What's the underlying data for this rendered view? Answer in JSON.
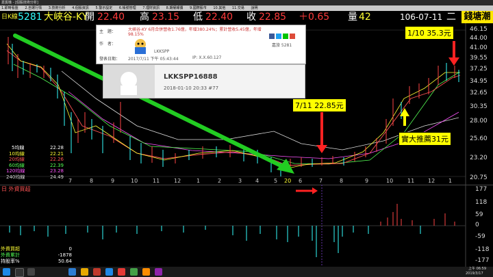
{
  "window": {
    "title": "嘉賓機 - [個股技術分析]",
    "menu": [
      "1.即時看盤",
      "2.自選行情",
      "3.技術分析",
      "4.個股資訊",
      "5.警示設定",
      "6.帳號管理",
      "7.理財資訊",
      "8.期權報價",
      "9.國際股市",
      "10.其他",
      "11.交易",
      "說明"
    ]
  },
  "quote": {
    "tag": "日K線",
    "code": "5281",
    "name": "大峽谷-KY",
    "open_label": "開",
    "open": "22.40",
    "high_label": "高",
    "high": "23.15",
    "low_label": "低",
    "low": "22.40",
    "close_label": "收",
    "close": "22.85",
    "change": "＋0.65",
    "volume_label": "量",
    "volume": "42",
    "date": "106-07-11",
    "weekday": "二",
    "brand": "錢塘潮"
  },
  "price_axis": [
    "46.15",
    "44.00",
    "41.00",
    "39.55",
    "37.25",
    "34.95",
    "32.65",
    "30.35",
    "28.00",
    "25.60",
    "23.20",
    "20.75"
  ],
  "x_axis": [
    "6",
    "7",
    "8",
    "9",
    "10",
    "11",
    "12",
    "1",
    "2",
    "3",
    "4",
    "5",
    "6",
    "7",
    "8",
    "9",
    "10",
    "11",
    "12",
    "1"
  ],
  "x_axis_special": "20",
  "ma_legend": [
    {
      "label": "5均線",
      "value": "22.28",
      "color": "#ffffff"
    },
    {
      "label": "10均線",
      "value": "22.21",
      "color": "#ffff33"
    },
    {
      "label": "20均線",
      "value": "22.26",
      "color": "#ff5555"
    },
    {
      "label": "60均線",
      "value": "22.39",
      "color": "#55ff55"
    },
    {
      "label": "120均線",
      "value": "23.28",
      "color": "#ff55ff"
    },
    {
      "label": "240均線",
      "value": "24.49",
      "color": "#dddddd"
    }
  ],
  "indicator": {
    "tag": "日 外資買超",
    "axis": [
      "177",
      "118",
      "59",
      "0",
      "-59",
      "-118",
      "-177"
    ],
    "legend": [
      {
        "label": "外資買超",
        "value": "0",
        "color": "#ffff33"
      },
      {
        "label": "外資累計",
        "value": "-1878",
        "color": "#55ff55"
      },
      {
        "label": "持股率%",
        "value": "50.64",
        "color": "#ffffff"
      }
    ]
  },
  "post": {
    "subject_label": "主　題：",
    "subject": "大峽谷-KY 6月合併營收1.76億，年增380.24%；累計營收5.45億，年增98.15%",
    "author_label": "作　者：",
    "author": "LKKSPP",
    "stock_label": "股票：",
    "stock_tag": "嘉旅 5281",
    "time_label": "發表日期：",
    "time": "2017/7/11 下午 05:43:44",
    "ip": "IP: X.X.60.127"
  },
  "profile": {
    "name": "LKKSPP16888",
    "meta": "2018-01-10 20:33  #77"
  },
  "callouts": {
    "right_top": "1/10 35.3元",
    "middle": "7/11 22.85元",
    "recommend": "實大推薦31元"
  },
  "taskbar": {
    "time": "上午 06:59",
    "date": "2019/3/17"
  }
}
